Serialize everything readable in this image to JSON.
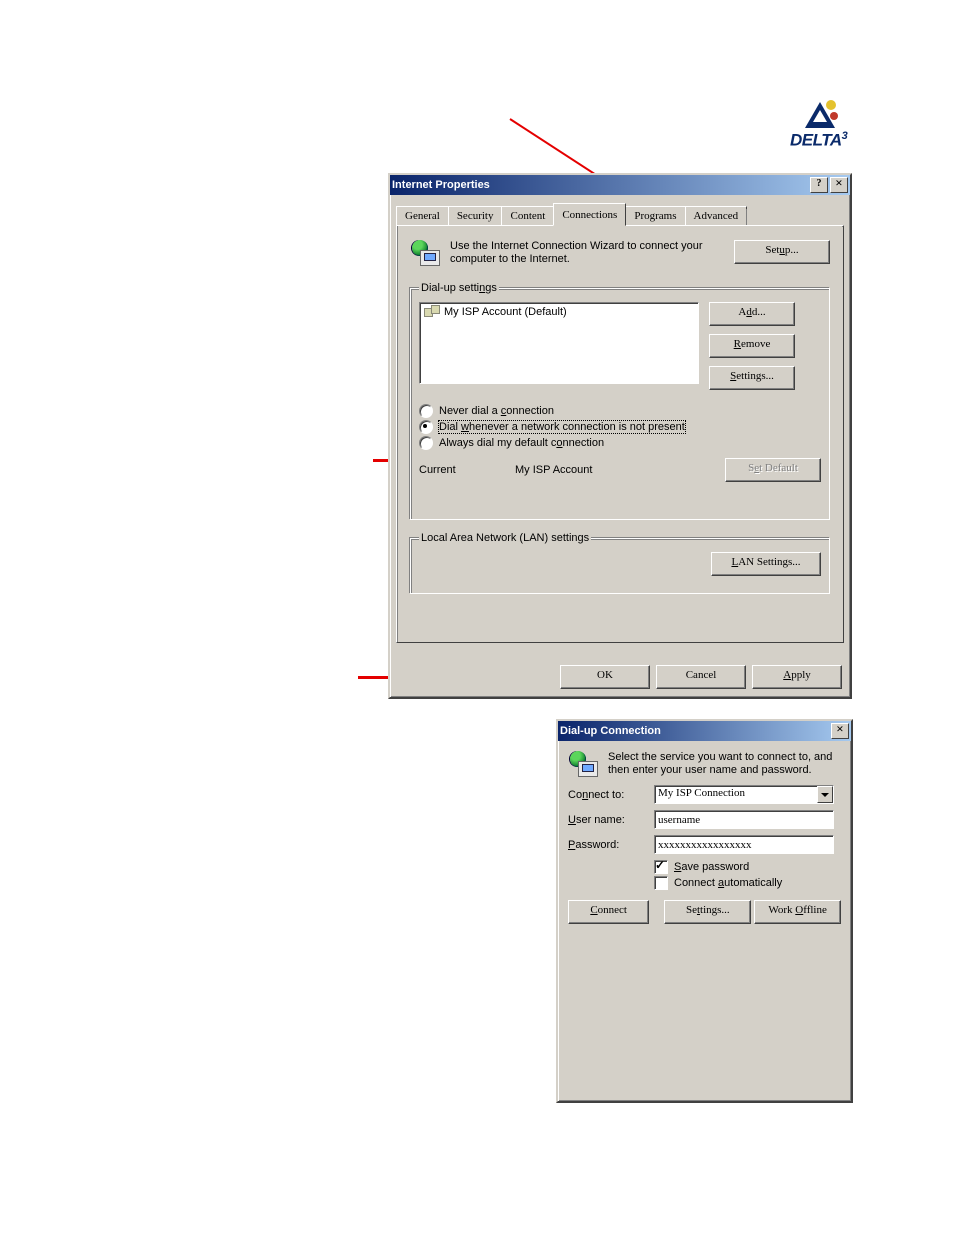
{
  "logo": {
    "text": "DELTA",
    "sup": "3"
  },
  "internet_properties": {
    "title": "Internet Properties",
    "help_btn": "?",
    "close_btn": "×",
    "tabs": [
      "General",
      "Security",
      "Content",
      "Connections",
      "Programs",
      "Advanced"
    ],
    "active_tab": "Connections",
    "intro_text": "Use the Internet Connection Wizard to connect your computer to the Internet.",
    "setup_btn": "Setup...",
    "dialup_legend": "Dial-up settings",
    "dialup_entries": [
      "My ISP Account (Default)"
    ],
    "btn_add": "Add...",
    "btn_remove": "Remove",
    "btn_settings": "Settings...",
    "radio_never": "Never dial a connection",
    "radio_dial_when": "Dial whenever a network connection is not present",
    "radio_always": "Always dial my default connection",
    "current_label": "Current",
    "current_value": "My ISP Account",
    "btn_set_default": "Set Default",
    "lan_legend": "Local Area Network (LAN) settings",
    "btn_lan": "LAN Settings...",
    "btn_ok": "OK",
    "btn_cancel": "Cancel",
    "btn_apply": "Apply"
  },
  "dialup_connection": {
    "title": "Dial-up Connection",
    "close_btn": "×",
    "intro_text": "Select the service you want to connect to, and then enter your user name and password.",
    "connect_to_label": "Connect to:",
    "connect_to_value": "My ISP Connection",
    "user_label": "User name:",
    "user_value": "username",
    "pass_label": "Password:",
    "pass_value": "xxxxxxxxxxxxxxxxx",
    "save_pw": "Save password",
    "auto_connect": "Connect automatically",
    "btn_connect": "Connect",
    "btn_settings": "Settings...",
    "btn_offline": "Work Offline"
  }
}
